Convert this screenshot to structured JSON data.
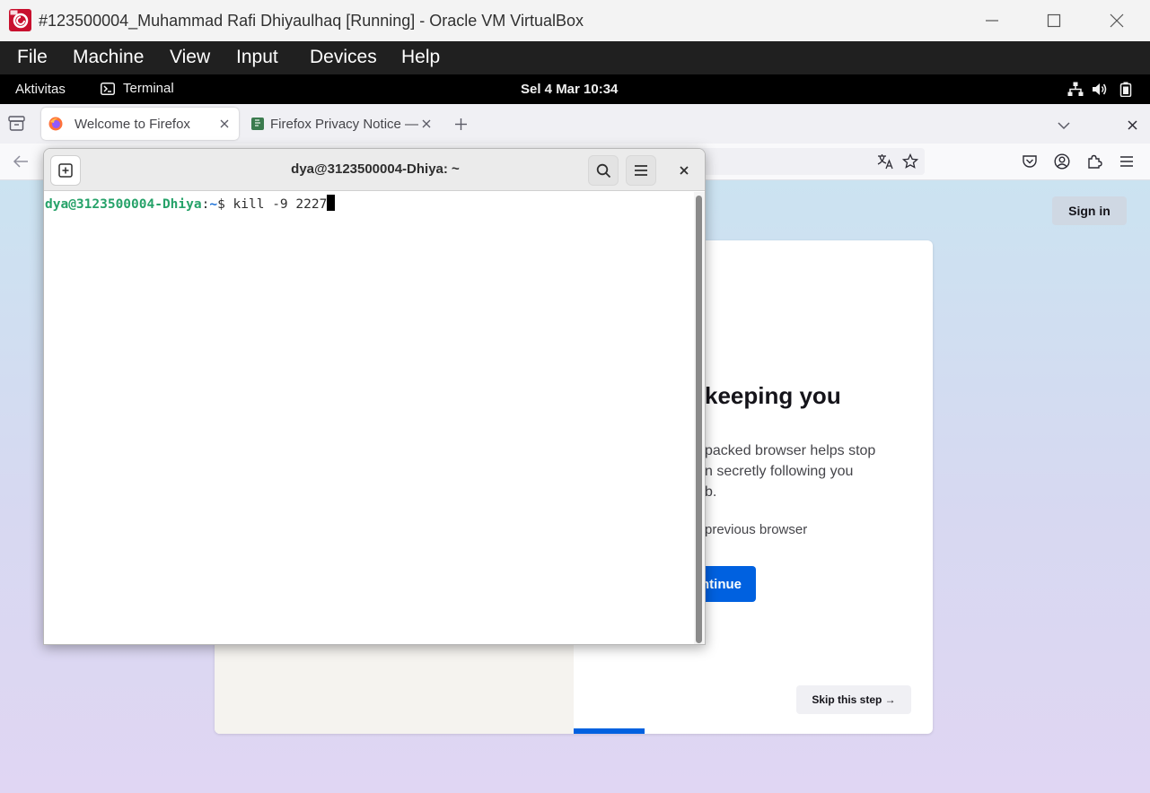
{
  "window": {
    "title": "#123500004_Muhammad Rafi Dhiyaulhaq [Running] - Oracle VM VirtualBox"
  },
  "vbox_menu": [
    "File",
    "Machine",
    "View",
    "Input",
    "Devices",
    "Help"
  ],
  "gnome": {
    "activities": "Aktivitas",
    "app_name": "Terminal",
    "clock": "Sel  4 Mar  10:34"
  },
  "firefox": {
    "tabs": [
      {
        "label": "Welcome to Firefox",
        "active": true
      },
      {
        "label": "Firefox Privacy Notice — |",
        "active": false
      }
    ],
    "sign_in": "Sign in",
    "card": {
      "heading": "keeping you",
      "body_1": "packed browser helps stop",
      "body_2": "n secretly following you",
      "body_3": "b.",
      "import_text": "previous browser",
      "continue": "ntinue",
      "skip": "Skip this step →"
    },
    "progress_fraction": 0.1
  },
  "terminal": {
    "title": "dya@3123500004-Dhiya: ~",
    "prompt_user": "dya@3123500004-Dhiya",
    "prompt_sep": ":",
    "prompt_path": "~",
    "prompt_sym": "$ ",
    "command": "kill -9 2227"
  },
  "colors": {
    "terminal_prompt_user": "#26a269",
    "terminal_prompt_path": "#1c71d8",
    "firefox_accent": "#0061e0",
    "vbox_menubar": "#202020",
    "gnome_bar": "#000000"
  }
}
